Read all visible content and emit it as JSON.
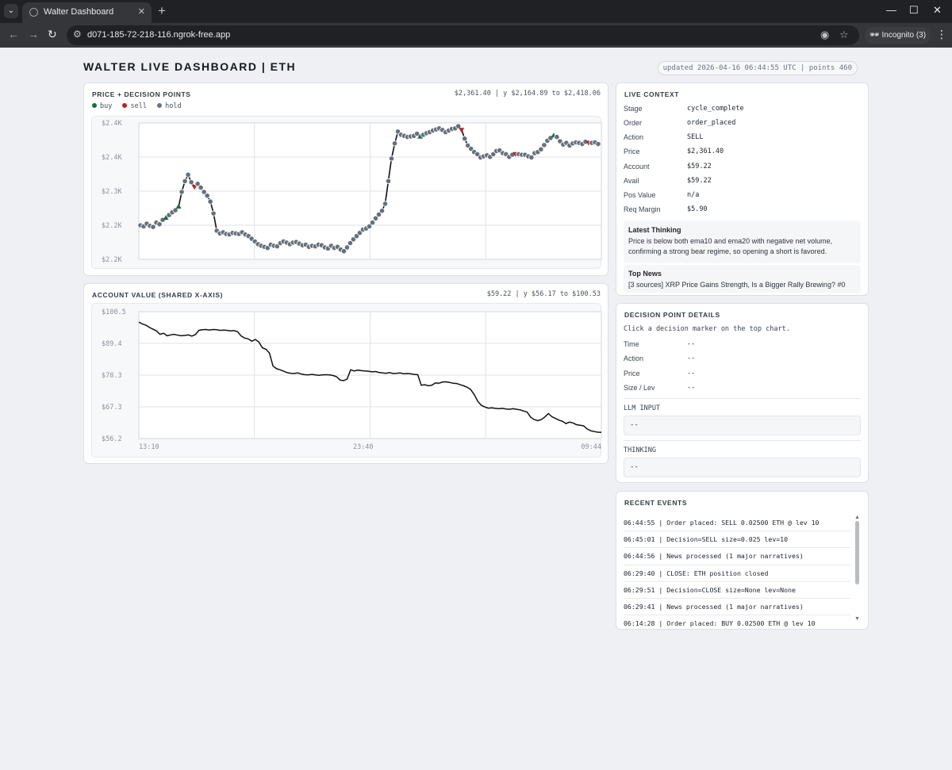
{
  "browser": {
    "tab_title": "Walter Dashboard",
    "url": "d071-185-72-218-116.ngrok-free.app",
    "incognito_label": "Incognito (3)"
  },
  "header": {
    "title": "WALTER LIVE DASHBOARD | ETH",
    "updated": "updated 2026-04-16 06:44:55 UTC | points 460"
  },
  "price_panel": {
    "title": "PRICE + DECISION POINTS",
    "summary": "$2,361.40 | y $2,164.89 to $2,418.06",
    "legend": [
      {
        "label": "buy",
        "color": "#1e6b45"
      },
      {
        "label": "sell",
        "color": "#b3262a"
      },
      {
        "label": "hold",
        "color": "#6b7380"
      }
    ]
  },
  "account_panel": {
    "title": "ACCOUNT VALUE (SHARED X-AXIS)",
    "summary": "$59.22 | y $56.17 to $100.53"
  },
  "chart_data": [
    {
      "type": "scatter",
      "name": "price",
      "y_ticks": [
        "$2.4K",
        "$2.4K",
        "$2.3K",
        "$2.2K",
        "$2.2K"
      ],
      "ylim": [
        2164.89,
        2418.06
      ],
      "grid": true,
      "values": [
        2228,
        2226,
        2231,
        2227,
        2225,
        2233,
        2230,
        2238,
        2241,
        2247,
        2252,
        2256,
        2262,
        2290,
        2310,
        2322,
        2308,
        2300,
        2305,
        2298,
        2290,
        2283,
        2272,
        2250,
        2218,
        2213,
        2215,
        2212,
        2211,
        2214,
        2213,
        2212,
        2215,
        2211,
        2208,
        2203,
        2198,
        2193,
        2190,
        2188,
        2186,
        2192,
        2190,
        2189,
        2195,
        2198,
        2196,
        2193,
        2196,
        2197,
        2194,
        2191,
        2192,
        2188,
        2190,
        2189,
        2192,
        2191,
        2187,
        2185,
        2190,
        2186,
        2188,
        2183,
        2180,
        2187,
        2195,
        2202,
        2208,
        2214,
        2220,
        2222,
        2226,
        2233,
        2241,
        2248,
        2255,
        2268,
        2310,
        2352,
        2380,
        2402,
        2396,
        2394,
        2392,
        2393,
        2394,
        2398,
        2392,
        2396,
        2399,
        2401,
        2404,
        2406,
        2408,
        2405,
        2401,
        2404,
        2407,
        2408,
        2412,
        2406,
        2389,
        2376,
        2370,
        2364,
        2360,
        2354,
        2356,
        2358,
        2355,
        2360,
        2366,
        2367,
        2362,
        2360,
        2355,
        2359,
        2361,
        2360,
        2359,
        2359,
        2356,
        2354,
        2362,
        2364,
        2369,
        2377,
        2385,
        2390,
        2394,
        2392,
        2384,
        2378,
        2381,
        2376,
        2380,
        2382,
        2381,
        2379,
        2383,
        2382,
        2381,
        2382,
        2379
      ]
    },
    {
      "type": "line",
      "name": "account",
      "x_ticks": [
        "13:10",
        "23:40",
        "09:44"
      ],
      "y_ticks": [
        "$100.5",
        "$89.4",
        "$78.3",
        "$67.3",
        "$56.2"
      ],
      "ylim": [
        56.17,
        100.53
      ],
      "grid": true,
      "values": [
        96.9,
        96.2,
        95.8,
        95.0,
        94.4,
        93.8,
        92.6,
        93.0,
        92.1,
        92.4,
        92.6,
        92.3,
        92.1,
        92.2,
        92.4,
        92.0,
        92.5,
        94.0,
        94.2,
        94.3,
        94.1,
        94.3,
        94.2,
        94.0,
        94.1,
        94.0,
        93.8,
        93.9,
        93.5,
        92.0,
        91.3,
        91.0,
        90.2,
        90.8,
        89.9,
        87.9,
        87.4,
        86.0,
        81.5,
        80.6,
        80.2,
        79.7,
        79.2,
        79.0,
        78.9,
        79.1,
        78.7,
        78.5,
        78.4,
        78.6,
        78.4,
        78.3,
        78.4,
        78.5,
        78.4,
        78.2,
        77.8,
        76.6,
        76.4,
        77.0,
        80.2,
        79.8,
        80.1,
        79.9,
        79.8,
        79.7,
        79.5,
        79.6,
        79.3,
        79.1,
        79.0,
        79.2,
        78.9,
        79.0,
        79.1,
        78.8,
        78.9,
        78.8,
        78.6,
        78.5,
        74.8,
        75.0,
        74.6,
        74.8,
        75.6,
        75.5,
        75.9,
        76.0,
        75.8,
        75.5,
        75.4,
        75.0,
        74.6,
        74.1,
        73.3,
        71.5,
        69.2,
        67.8,
        67.2,
        66.8,
        66.9,
        66.7,
        66.6,
        66.7,
        66.5,
        66.4,
        66.6,
        66.4,
        66.2,
        65.8,
        65.4,
        63.6,
        62.8,
        62.4,
        62.8,
        63.7,
        64.9,
        63.8,
        63.2,
        62.6,
        62.2,
        61.4,
        61.9,
        61.6,
        61.0,
        60.8,
        60.6,
        59.5,
        58.9,
        58.6,
        58.4,
        58.3
      ]
    }
  ],
  "live_context": {
    "title": "LIVE CONTEXT",
    "rows": [
      {
        "key": "Stage",
        "value": "cycle_complete"
      },
      {
        "key": "Order",
        "value": "order_placed"
      },
      {
        "key": "Action",
        "value": "SELL"
      },
      {
        "key": "Price",
        "value": "$2,361.40"
      },
      {
        "key": "Account",
        "value": "$59.22"
      },
      {
        "key": "Avail",
        "value": "$59.22"
      },
      {
        "key": "Pos Value",
        "value": "n/a"
      },
      {
        "key": "Req Margin",
        "value": "$5.90"
      }
    ],
    "thinking_title": "Latest Thinking",
    "thinking_text": "Price is below both ema10 and ema20 with negative net volume, confirming a strong bear regime, so opening a short is favored.",
    "news_title": "Top News",
    "news_text": "[3 sources] XRP Price Gains Strength, Is a Bigger Rally Brewing? #0"
  },
  "decision_details": {
    "title": "DECISION POINT DETAILS",
    "hint": "Click a decision marker on the top chart.",
    "rows": [
      {
        "key": "Time",
        "value": "--"
      },
      {
        "key": "Action",
        "value": "--"
      },
      {
        "key": "Price",
        "value": "--"
      },
      {
        "key": "Size / Lev",
        "value": "--"
      }
    ],
    "llm_input_label": "LLM INPUT",
    "llm_input_value": "--",
    "thinking_label": "THINKING",
    "thinking_value": "--"
  },
  "recent_events": {
    "title": "RECENT EVENTS",
    "items": [
      "06:44:55 | Order placed: SELL 0.02500 ETH @ lev 10",
      "06:45:01 | Decision=SELL size=0.025 lev=10",
      "06:44:56 | News processed (1 major narratives)",
      "06:29:40 | CLOSE: ETH position closed",
      "06:29:51 | Decision=CLOSE size=None lev=None",
      "06:29:41 | News processed (1 major narratives)",
      "06:14:28 | Order placed: BUY 0.02500 ETH @ lev 10"
    ]
  }
}
